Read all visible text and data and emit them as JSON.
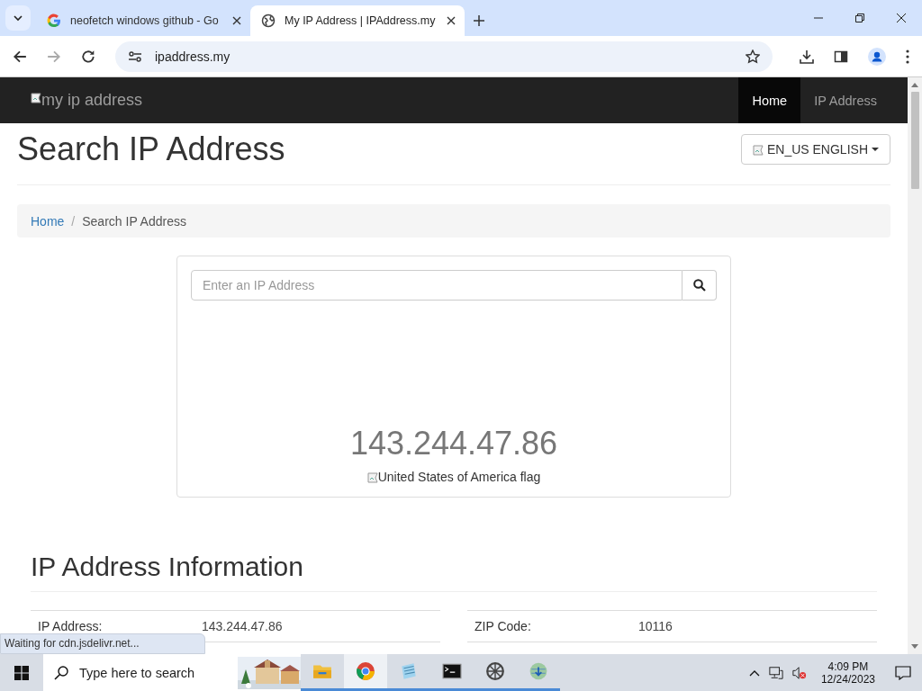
{
  "tabs": [
    {
      "title": "neofetch windows github - Go",
      "kind": "google",
      "selected": false
    },
    {
      "title": "My IP Address | IPAddress.my",
      "kind": "globe",
      "selected": true
    }
  ],
  "address_bar": {
    "url": "ipaddress.my"
  },
  "navbar": {
    "brand_alt": "my ip address",
    "links": [
      {
        "label": "Home",
        "selected": true
      },
      {
        "label": "IP Address",
        "selected": false
      }
    ]
  },
  "heading": "Search IP Address",
  "language_button": "EN_US ENGLISH",
  "breadcrumb": [
    "Home",
    "Search IP Address"
  ],
  "breadcrumb_separator": "/",
  "search": {
    "placeholder": "Enter an IP Address"
  },
  "ip": "143.244.47.86",
  "flag_alt": "United States of America flag",
  "info": {
    "title": "IP Address Information",
    "left_rows": [
      {
        "label": "IP Address:",
        "value": "143.244.47.86"
      }
    ],
    "right_rows": [
      {
        "label": "ZIP Code:",
        "value": "10116"
      }
    ]
  },
  "status_text": "Waiting for cdn.jsdelivr.net...",
  "taskbar": {
    "search_placeholder": "Type here to search",
    "time": "4:09 PM",
    "date": "12/24/2023"
  }
}
